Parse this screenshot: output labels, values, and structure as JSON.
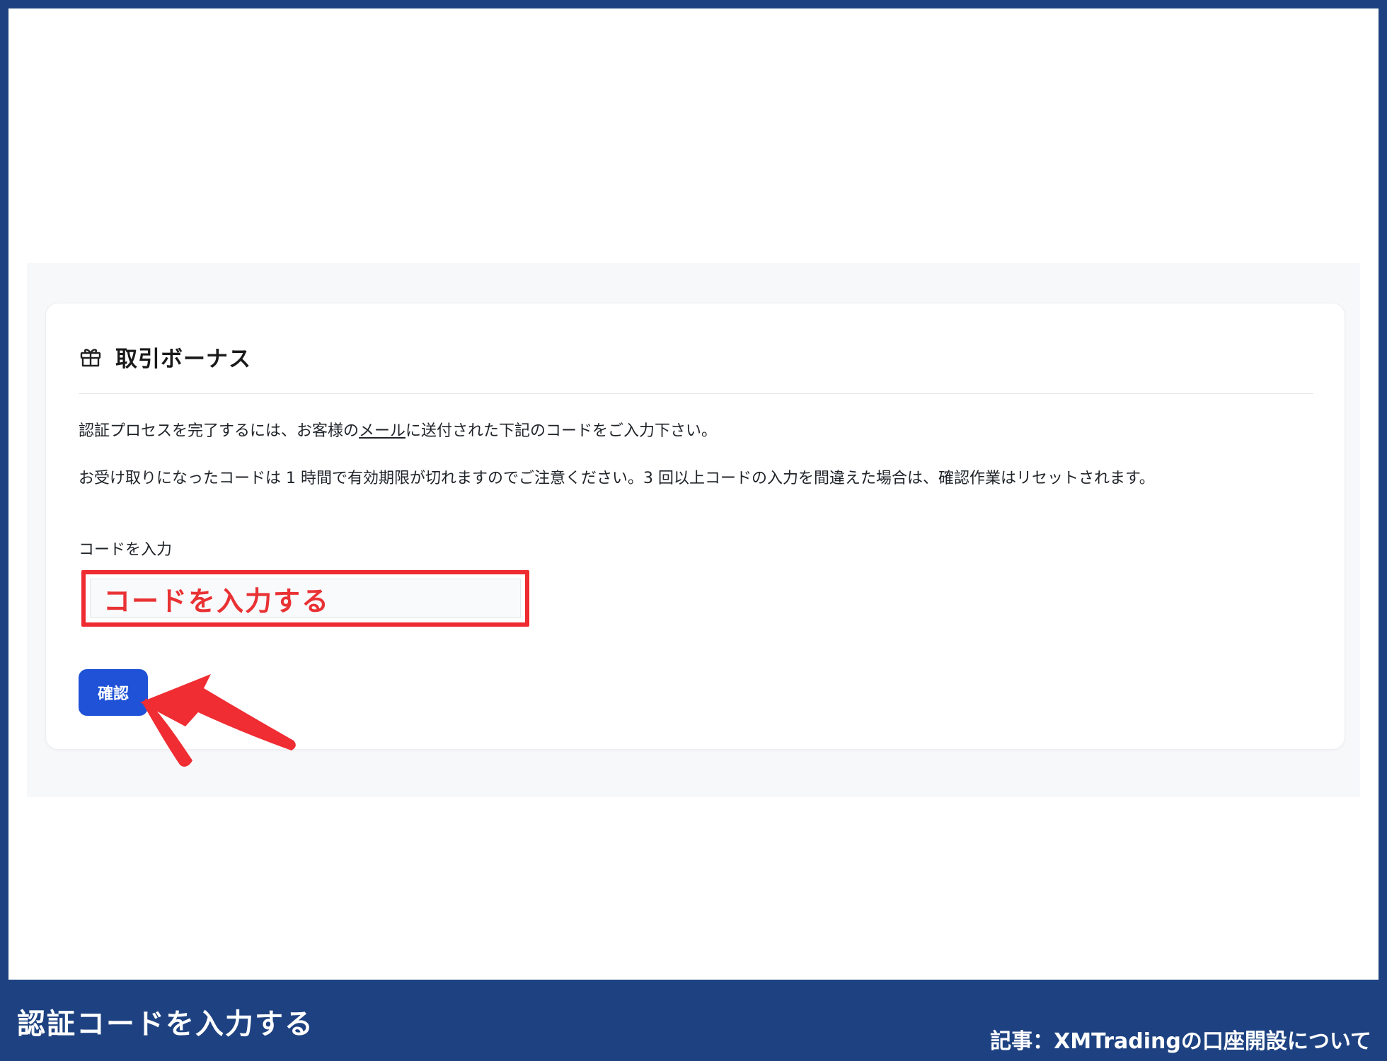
{
  "card": {
    "title": "取引ボーナス",
    "message1_pre": "認証プロセスを完了するには、お客様の",
    "message1_link": "メール",
    "message1_post": "に送付された下記のコードをご入力下さい。",
    "message2": "お受け取りになったコードは 1 時間で有効期限が切れますのでご注意ください。3 回以上コードの入力を間違えた場合は、確認作業はリセットされます。",
    "field_label": "コードを入力",
    "input_annotation": "コードを入力する",
    "confirm_label": "確認"
  },
  "footer": {
    "title": "認証コードを入力する",
    "source": "記事：XMTradingの口座開設について"
  },
  "colors": {
    "frame": "#1e4281",
    "button": "#1f52d6",
    "highlight": "#ee2b30"
  },
  "icons": {
    "header_icon": "gift-icon",
    "annotation": "arrow-icon"
  }
}
